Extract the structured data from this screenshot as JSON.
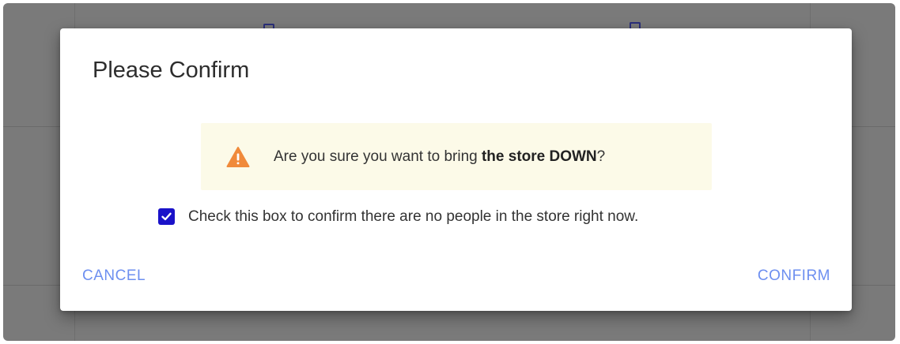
{
  "dialog": {
    "title": "Please Confirm",
    "warning": {
      "icon": "warning-triangle-icon",
      "text_before": "Are you sure you want to bring ",
      "text_bold": "the store DOWN",
      "text_after": "?"
    },
    "confirm_checkbox": {
      "checked": true,
      "label": "Check this box to confirm there are no people in the store right now."
    },
    "buttons": {
      "cancel_label": "CANCEL",
      "confirm_label": "CONFIRM"
    }
  },
  "colors": {
    "accent": "#6d8ff0",
    "checkbox": "#1a12c9",
    "warning_bg": "#fcfae8",
    "warning_icon": "#f08a3a",
    "backdrop": "#7a7a7a"
  }
}
